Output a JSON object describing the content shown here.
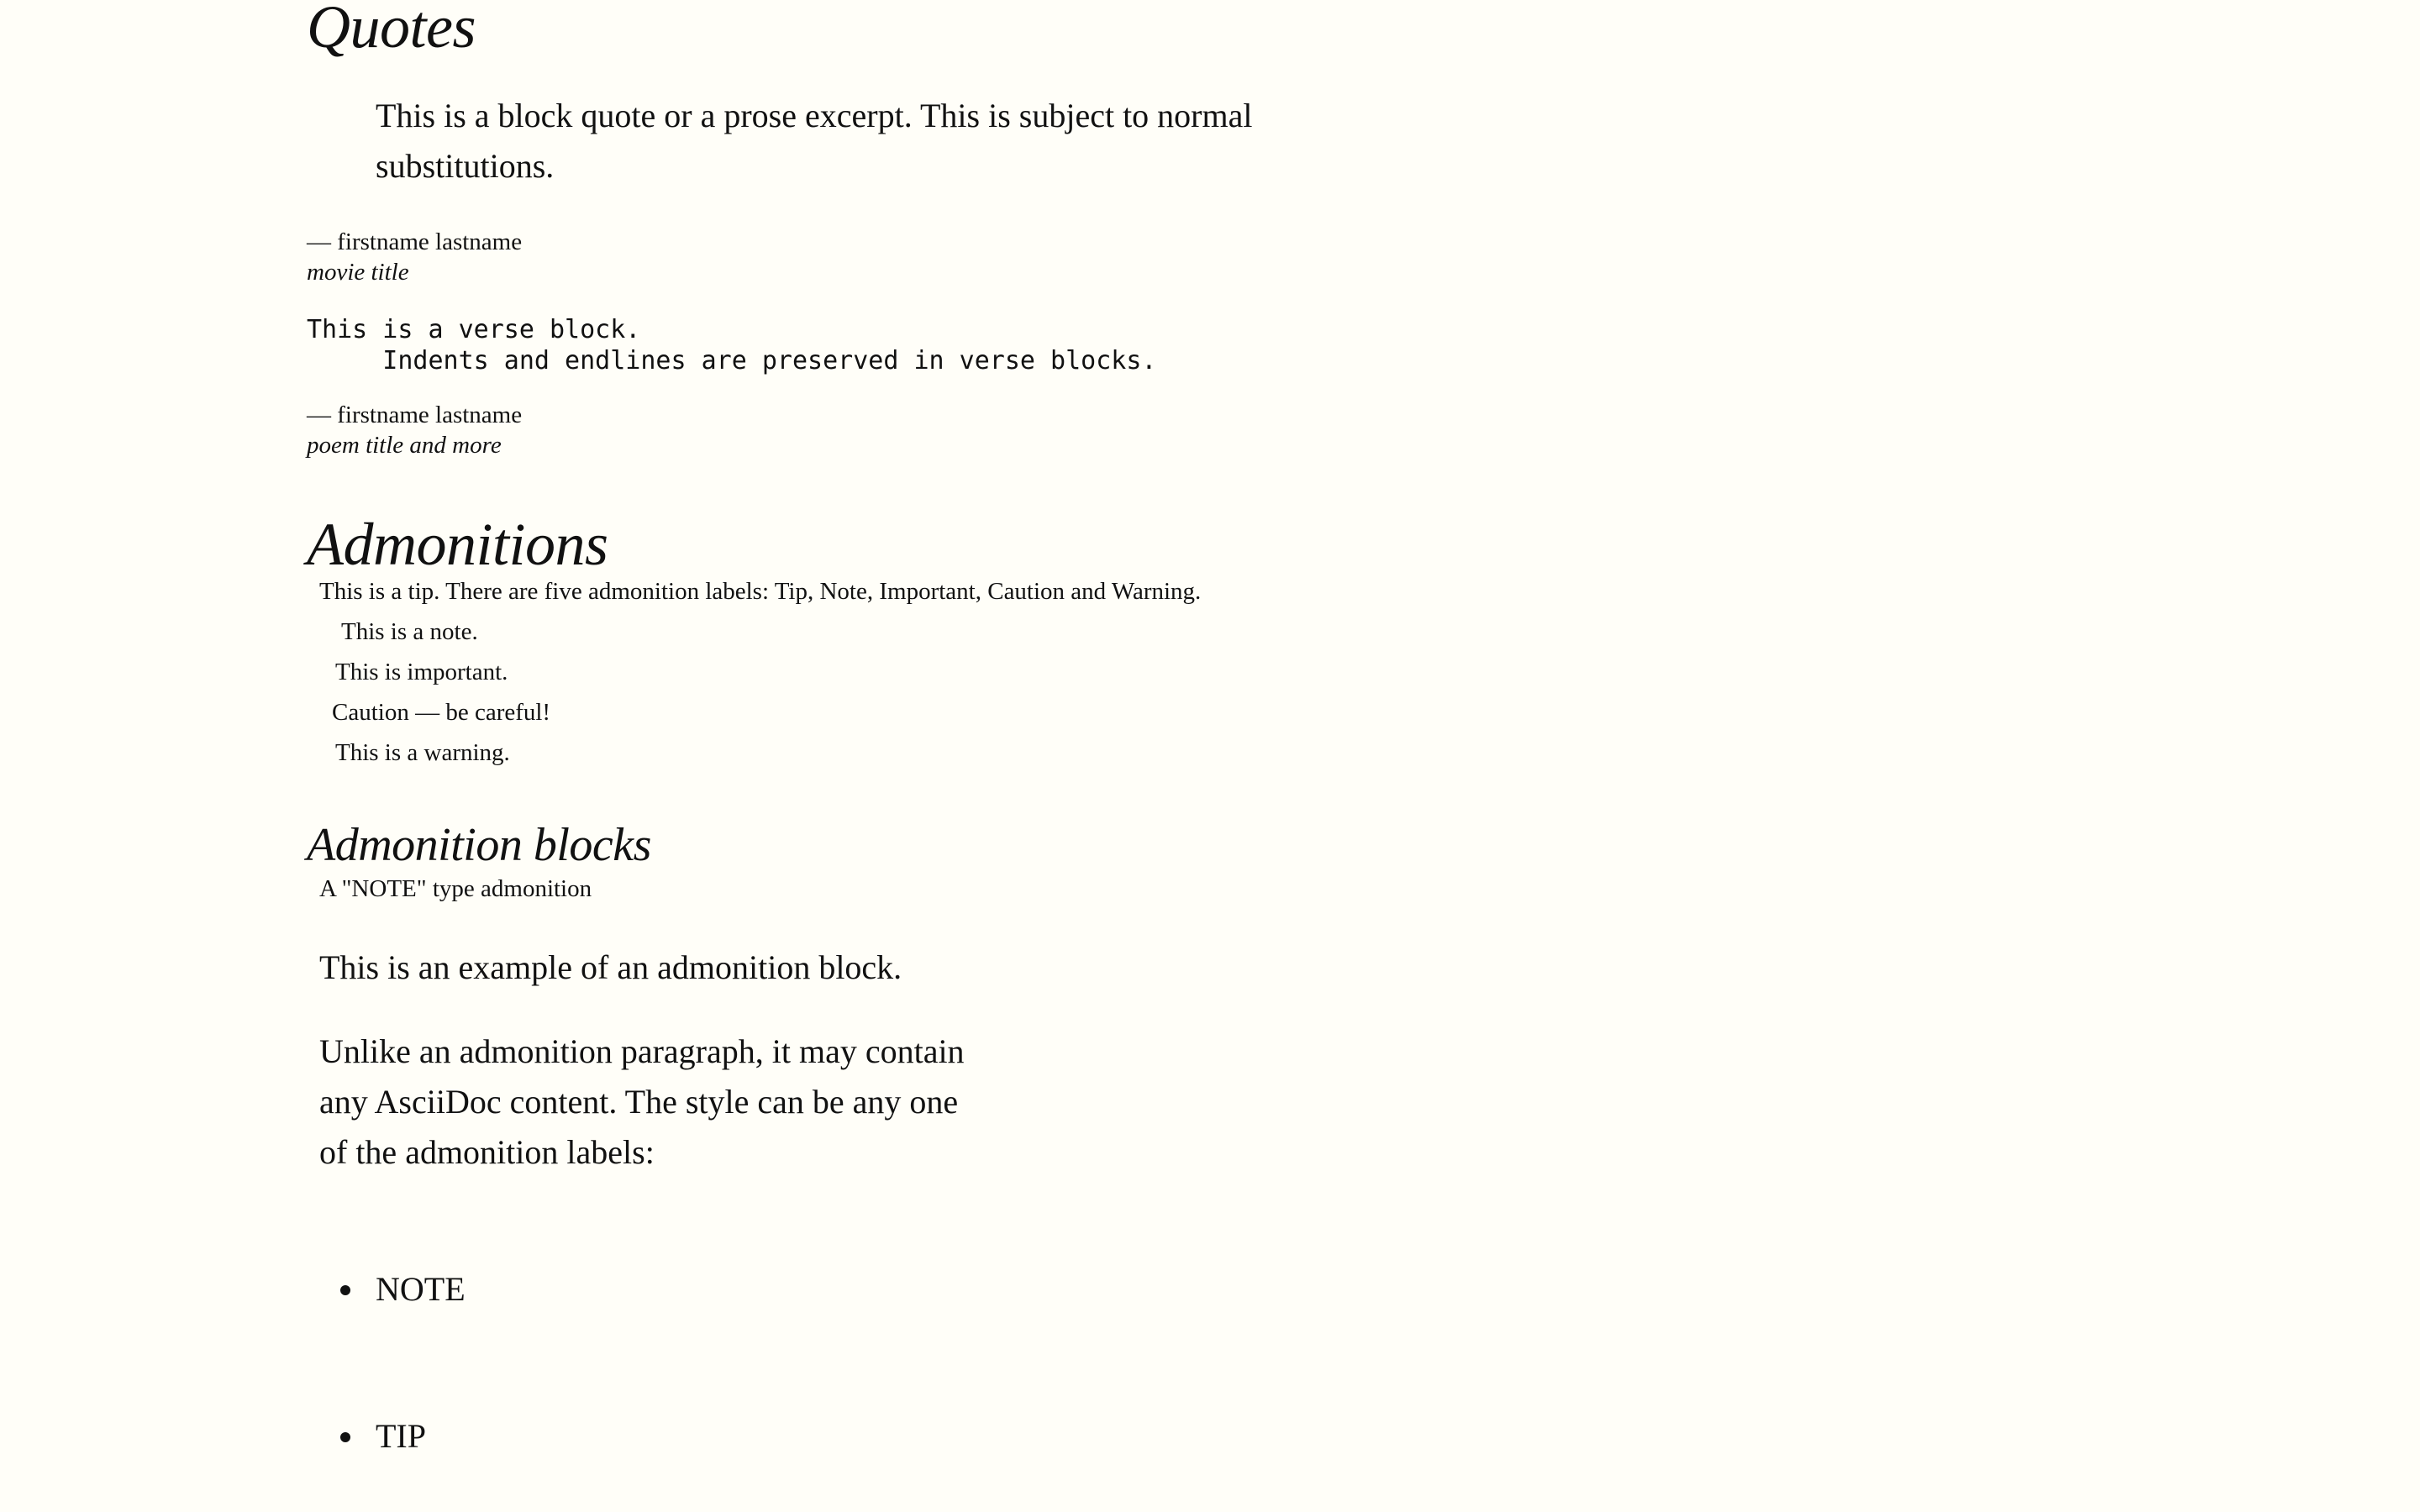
{
  "quotes": {
    "heading": "Quotes",
    "blockquote": "This is a block quote or a prose excerpt. This is subject to normal substitutions.",
    "attribution": "— firstname lastname",
    "citetitle": "movie title"
  },
  "verse": {
    "line1": "This is a verse block.",
    "line2": "     Indents and endlines are preserved in verse blocks.",
    "attribution": "— firstname lastname",
    "citetitle": "poem title and more"
  },
  "admonitions": {
    "heading": "Admonitions",
    "items": [
      "This is a tip. There are five admonition labels: Tip, Note, Important, Caution and Warning.",
      "This is a note.",
      "This is important.",
      "Caution — be careful!",
      "This is a warning."
    ]
  },
  "admonition_blocks": {
    "heading": "Admonition blocks",
    "caption": "A \"NOTE\" type admonition",
    "para1": "This is an example of an admonition block.",
    "para2": "Unlike an admonition paragraph, it may contain any AsciiDoc content. The style can be any one of the admonition labels:",
    "labels": [
      "NOTE",
      "TIP"
    ]
  }
}
